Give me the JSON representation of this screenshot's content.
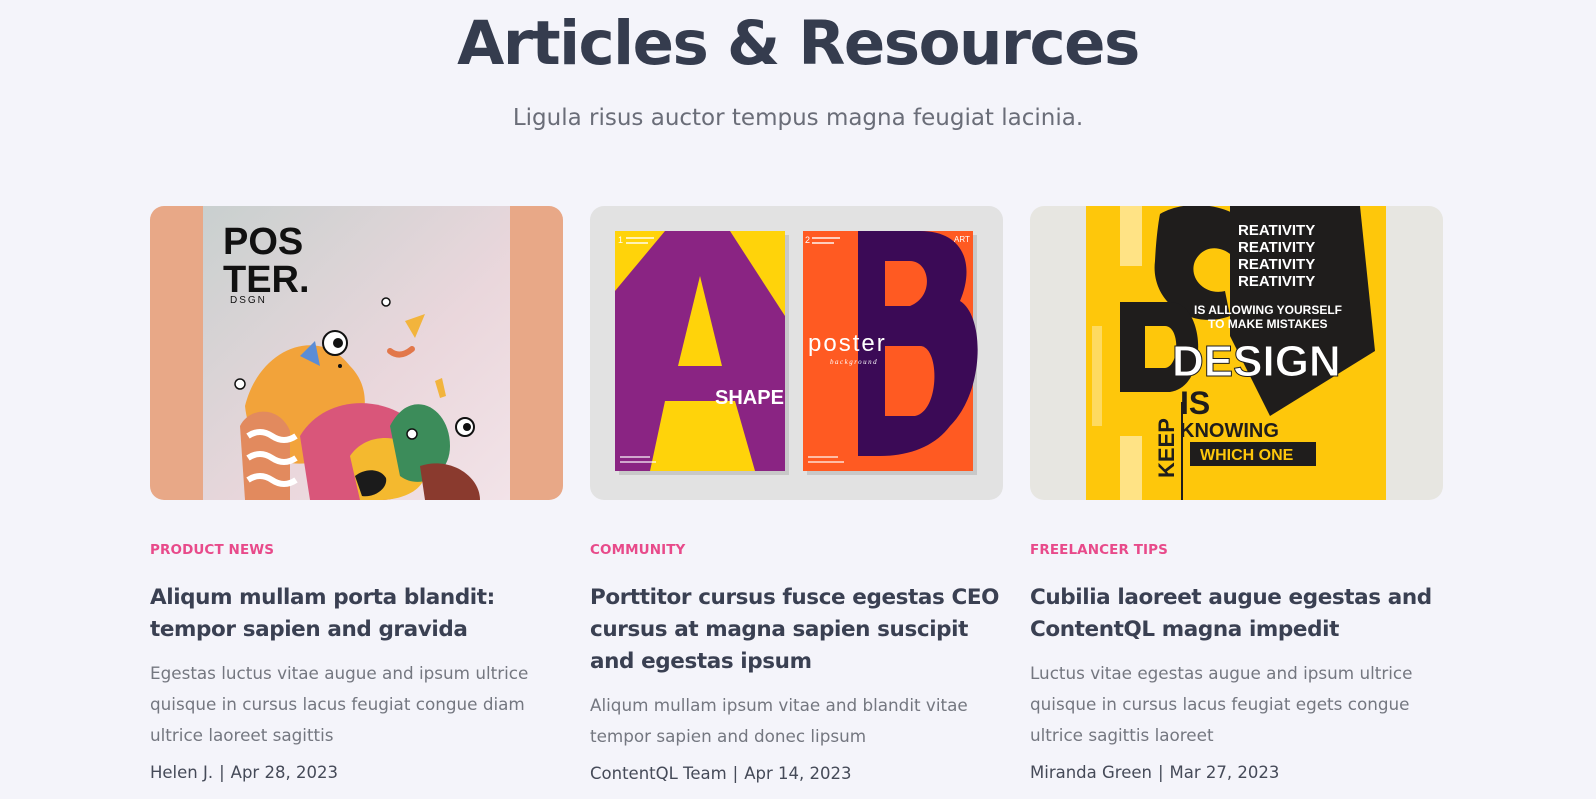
{
  "section": {
    "title": "Articles & Resources",
    "subtitle": "Ligula risus auctor tempus magna feugiat lacinia."
  },
  "articles": [
    {
      "category": "PRODUCT NEWS",
      "title": "Aliqum mullam porta blandit: tempor sapien and gravida",
      "excerpt": "Egestas luctus vitae augue and ipsum ultrice quisque in cursus lacus feugiat congue diam ultrice laoreet sagittis",
      "author": "Helen J.",
      "date": "Apr 28, 2023",
      "image": {
        "line1": "POS",
        "line2": "TER.",
        "line3": "DSGN"
      }
    },
    {
      "category": "COMMUNITY",
      "title": "Porttitor cursus fusce egestas CEO cursus at magna sapien suscipit and egestas ipsum",
      "excerpt": "Aliqum mullam ipsum vitae and blandit vitae tempor sapien and donec lipsum",
      "author": "ContentQL Team",
      "date": "Apr 14, 2023",
      "image": {
        "letter_a": "A",
        "letter_b": "B",
        "shape": "SHAPE",
        "poster": "poster",
        "background": "background",
        "art": "ART",
        "num1": "1",
        "num2": "2"
      }
    },
    {
      "category": "FREELANCER TIPS",
      "title": "Cubilia laoreet augue egestas and ContentQL magna impedit",
      "excerpt": "Luctus vitae egestas augue and ipsum ultrice quisque in cursus lacus feugiat egets congue ultrice sagittis laoreet",
      "author": "Miranda Green",
      "date": "Mar 27, 2023",
      "image": {
        "c": "C",
        "reativity": "REATIVITY",
        "allowing": "IS ALLOWING YOURSELF",
        "mistakes": "TO MAKE MISTAKES",
        "design": "DESIGN",
        "keep": "KEEP",
        "is": "IS",
        "knowing": "KNOWING",
        "which": "WHICH ONE"
      }
    }
  ],
  "colors": {
    "accent": "#e84a8a",
    "heading": "#353c4e",
    "background": "#f4f4fa"
  }
}
